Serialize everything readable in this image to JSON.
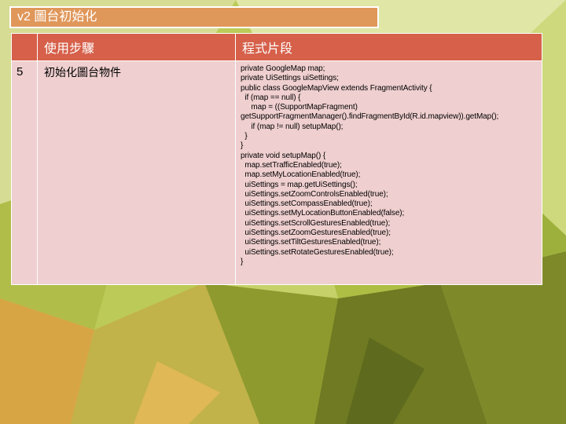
{
  "slide": {
    "title": "v2 圖台初始化",
    "table": {
      "headers": [
        "",
        "使用步驟",
        "程式片段"
      ],
      "row": {
        "number": "5",
        "step": "初始化圖台物件",
        "code_lines": [
          "private GoogleMap map;",
          "private UiSettings uiSettings;",
          "public class GoogleMapView extends FragmentActivity {",
          "  if (map == null) {",
          "     map = ((SupportMapFragment)",
          "getSupportFragmentManager().findFragmentById(R.id.mapview)).getMap();",
          "     if (map != null) setupMap();",
          "  }",
          "}",
          "private void setupMap() {",
          "  map.setTrafficEnabled(true);",
          "  map.setMyLocationEnabled(true);",
          "  uiSettings = map.getUiSettings();",
          "  uiSettings.setZoomControlsEnabled(true);",
          "  uiSettings.setCompassEnabled(true);",
          "  uiSettings.setMyLocationButtonEnabled(false);",
          "  uiSettings.setScrollGesturesEnabled(true);",
          "  uiSettings.setZoomGesturesEnabled(true);",
          "  uiSettings.setTiltGesturesEnabled(true);",
          "  uiSettings.setRotateGesturesEnabled(true);",
          "}"
        ]
      }
    }
  },
  "colors": {
    "title_bg": "#e0975a",
    "header_bg": "#d6604a",
    "cell_bg": "#efcfcf"
  }
}
